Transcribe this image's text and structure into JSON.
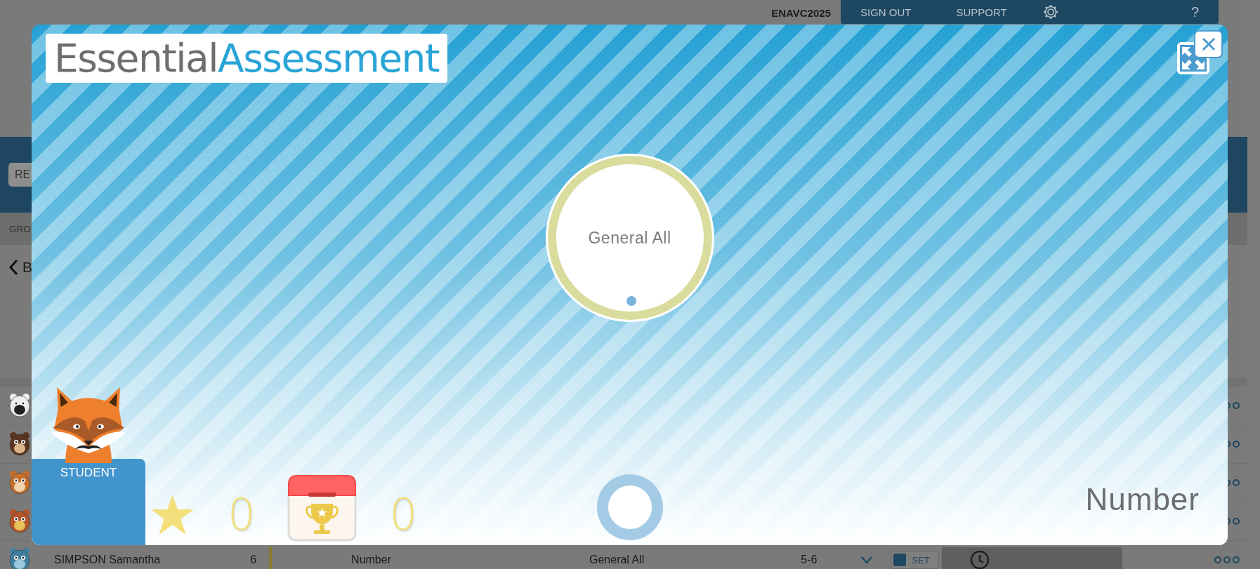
{
  "background": {
    "account": "ENAVC2025",
    "nav": [
      {
        "label": "SIGN OUT"
      },
      {
        "label": "SUPPORT"
      }
    ],
    "help": "?",
    "toolbar_button": "RE",
    "group_tab": "GRO",
    "back_link": "B",
    "rows": [
      {
        "name": "SIMPSON Samantha",
        "column_2": "6",
        "strand": "Number",
        "focus": "General All",
        "level_range": "5-6",
        "set_label": "SET"
      }
    ]
  },
  "modal": {
    "logo": {
      "first": "Essential",
      "second": "Assessment"
    },
    "focus": "General All",
    "role_label": "STUDENT",
    "stars_count": "0",
    "trophies_count": "0",
    "strand": "Number"
  }
}
